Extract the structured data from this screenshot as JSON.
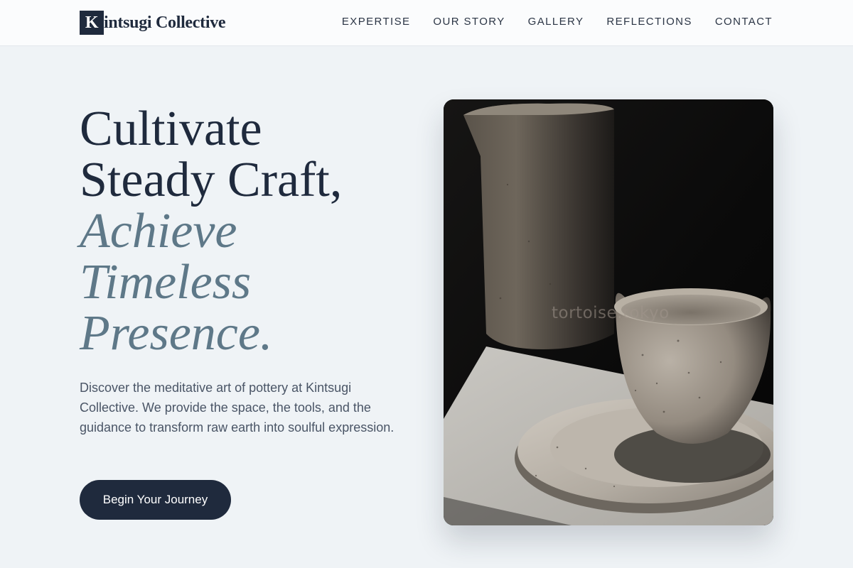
{
  "brand": {
    "mark": "K",
    "name_rest": "intsugi Collective"
  },
  "nav": {
    "items": [
      {
        "label": "EXPERTISE"
      },
      {
        "label": "OUR STORY"
      },
      {
        "label": "GALLERY"
      },
      {
        "label": "REFLECTIONS"
      },
      {
        "label": "CONTACT"
      }
    ]
  },
  "hero": {
    "headline_line1": "Cultivate",
    "headline_line2": "Steady Craft,",
    "headline_line3": "Achieve",
    "headline_line4": "Timeless",
    "headline_line5": "Presence.",
    "description": "Discover the meditative art of pottery at Kintsugi Collective. We provide the space, the tools, and the guidance to transform raw earth into soulful expression.",
    "cta_label": "Begin Your Journey",
    "image_watermark": "tortoise.tokyo"
  },
  "colors": {
    "background": "#eff3f6",
    "primary": "#1f2a3d",
    "accent_muted": "#5e7888",
    "body_text": "#4a5566"
  },
  "icons": {
    "logo": "k-monogram-icon"
  }
}
